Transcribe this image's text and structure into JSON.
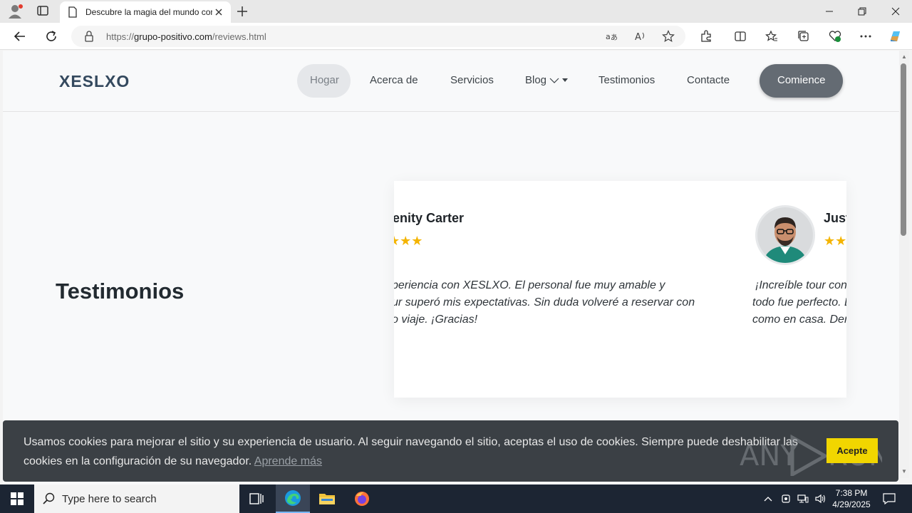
{
  "browser": {
    "tab_title": "Descubre la magia del mundo con",
    "url_prefix": "https://",
    "url_domain": "grupo-positivo.com",
    "url_path": "/reviews.html"
  },
  "site": {
    "logo": "XESLXO",
    "nav": {
      "home": "Hogar",
      "about": "Acerca de",
      "services": "Servicios",
      "blog": "Blog",
      "testimonials": "Testimonios",
      "contact": "Contacte",
      "cta": "Comience"
    },
    "section_title": "Testimonios",
    "testimonials": [
      {
        "name": "enity Carter",
        "stars": "★★★",
        "quote_lines": [
          "periencia con XESLXO. El personal fue muy amable y",
          "ur superó mis expectativas. Sin duda volveré a reservar con",
          "o viaje. ¡Gracias!"
        ]
      },
      {
        "name": "Just",
        "stars": "★★",
        "quote_lines": [
          "¡Increíble tour con",
          "todo fue perfecto. L",
          "como en casa. Der"
        ]
      }
    ]
  },
  "cookie": {
    "text": "Usamos cookies para mejorar el sitio y su experiencia de usuario. Al seguir navegando el sitio, aceptas el uso de cookies. Siempre puede deshabilitar las cookies en la configuración de su navegador.",
    "link": "Aprende más",
    "accept": "Acepte"
  },
  "watermark": {
    "left": "ANY",
    "right": "RUN"
  },
  "taskbar": {
    "search_placeholder": "Type here to search",
    "time": "7:38 PM",
    "date": "4/29/2025"
  },
  "colors": {
    "accent_button": "#646b73",
    "star": "#f4b400",
    "cookie_accept": "#f1d600"
  }
}
